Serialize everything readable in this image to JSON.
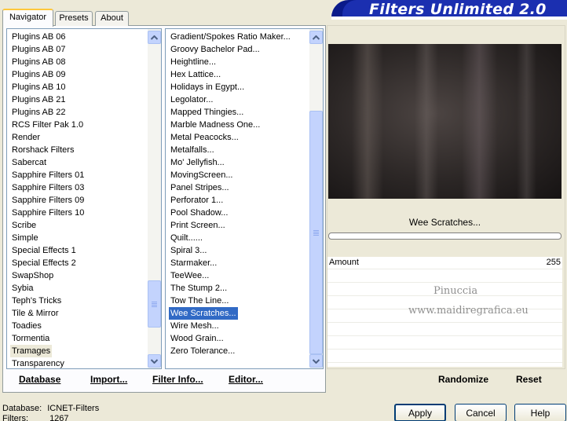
{
  "tabs": [
    "Navigator",
    "Presets",
    "About"
  ],
  "banner": {
    "title": "Filters Unlimited 2.0"
  },
  "categories": {
    "items": [
      "Plugins AB 06",
      "Plugins AB 07",
      "Plugins AB 08",
      "Plugins AB 09",
      "Plugins AB 10",
      "Plugins AB 21",
      "Plugins AB 22",
      "RCS Filter Pak 1.0",
      "Render",
      "Rorshack Filters",
      "Sabercat",
      "Sapphire Filters 01",
      "Sapphire Filters 03",
      "Sapphire Filters 09",
      "Sapphire Filters 10",
      "Scribe",
      "Simple",
      "Special Effects 1",
      "Special Effects 2",
      "SwapShop",
      "Sybia",
      "Teph's Tricks",
      "Tile & Mirror",
      "Toadies",
      "Tormentia",
      "Tramages",
      "Transparency"
    ],
    "highlighted": "Tramages"
  },
  "filters": {
    "items": [
      "Gradient/Spokes Ratio Maker...",
      "Groovy Bachelor Pad...",
      "Heightline...",
      "Hex Lattice...",
      "Holidays in Egypt...",
      "Legolator...",
      "Mapped Thingies...",
      "Marble Madness One...",
      "Metal Peacocks...",
      "Metalfalls...",
      "Mo' Jellyfish...",
      "MovingScreen...",
      "Panel Stripes...",
      "Perforator 1...",
      "Pool Shadow...",
      "Print Screen...",
      "Quilt......",
      "Spiral 3...",
      "Starmaker...",
      "TeeWee...",
      "The Stump 2...",
      "Tow The Line...",
      "Wee Scratches...",
      "Wire Mesh...",
      "Wood Grain...",
      "Zero Tolerance..."
    ],
    "selected": "Wee Scratches..."
  },
  "bottom_links": {
    "database": "Database",
    "import": "Import...",
    "filter_info": "Filter Info...",
    "editor": "Editor...",
    "randomize": "Randomize",
    "reset": "Reset"
  },
  "preview": {
    "filter_name": "Wee Scratches..."
  },
  "params": [
    {
      "label": "Amount",
      "value": "255"
    }
  ],
  "watermark": {
    "line1": "Pinuccia",
    "line2": "www.maidiregrafica.eu"
  },
  "status": {
    "database_label": "Database:",
    "database_value": "ICNET-Filters",
    "filters_label": "Filters:",
    "filters_value": "1267"
  },
  "dialog_buttons": {
    "apply": "Apply",
    "cancel": "Cancel",
    "help": "Help"
  },
  "colors": {
    "selection": "#316ac5",
    "banner": "#1b2fb0",
    "dialog_bg": "#ece9d8"
  }
}
